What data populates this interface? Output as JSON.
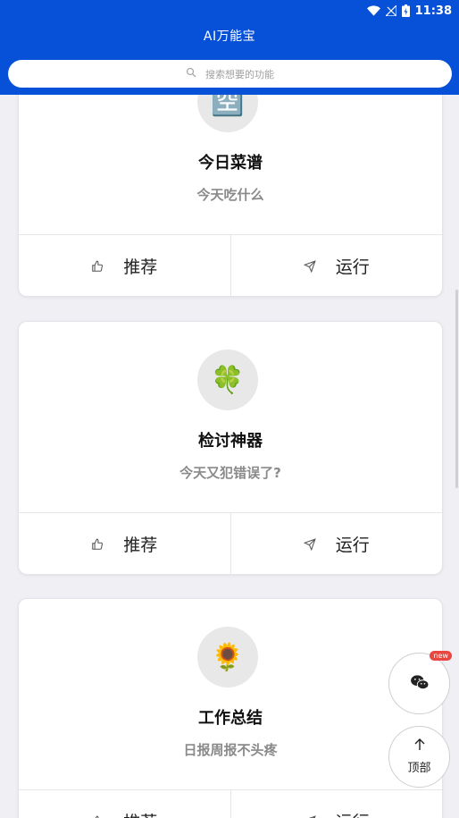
{
  "status": {
    "time": "11:38"
  },
  "header": {
    "title": "AI万能宝"
  },
  "search": {
    "placeholder": "搜索想要的功能"
  },
  "cards": [
    {
      "icon": "🈳",
      "icon_name": "placeholder-glyph-icon",
      "title": "今日菜谱",
      "subtitle": "今天吃什么",
      "recommend_label": "推荐",
      "run_label": "运行"
    },
    {
      "icon": "🍀",
      "icon_name": "clover-icon",
      "title": "检讨神器",
      "subtitle": "今天又犯错误了?",
      "recommend_label": "推荐",
      "run_label": "运行"
    },
    {
      "icon": "🌻",
      "icon_name": "sunflower-icon",
      "title": "工作总结",
      "subtitle": "日报周报不头疼",
      "recommend_label": "推荐",
      "run_label": "运行"
    }
  ],
  "fab": {
    "new_badge": "new",
    "top_label": "顶部"
  },
  "colors": {
    "brand": "#0750d8",
    "badge": "#e8463f"
  }
}
